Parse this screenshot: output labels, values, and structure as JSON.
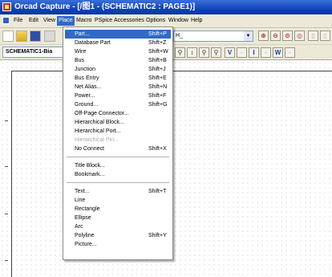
{
  "title_bar": {
    "title": "Orcad Capture - [/图1 - (SCHEMATIC2 : PAGE1)]"
  },
  "menu_bar": {
    "items": [
      "File",
      "Edit",
      "View",
      "Place",
      "Macro",
      "PSpice",
      "Accessories",
      "Options",
      "Window",
      "Help"
    ],
    "active": "Place"
  },
  "toolbar": {
    "part_combo": "H_",
    "sheet_tab": "SCHEMATIC1-Bia"
  },
  "place_menu": {
    "groups": [
      [
        {
          "label": "Part...",
          "shortcut": "Shift+P",
          "highlighted": true
        },
        {
          "label": "Database Part",
          "shortcut": "Shift+Z"
        },
        {
          "label": "Wire",
          "shortcut": "Shift+W"
        },
        {
          "label": "Bus",
          "shortcut": "Shift+B"
        },
        {
          "label": "Junction",
          "shortcut": "Shift+J"
        },
        {
          "label": "Bus Entry",
          "shortcut": "Shift+E"
        },
        {
          "label": "Net Alias...",
          "shortcut": "Shift+N"
        },
        {
          "label": "Power...",
          "shortcut": "Shift+F"
        },
        {
          "label": "Ground...",
          "shortcut": "Shift+G"
        },
        {
          "label": "Off-Page Connector...",
          "shortcut": ""
        },
        {
          "label": "Hierarchical Block...",
          "shortcut": ""
        },
        {
          "label": "Hierarchical Port...",
          "shortcut": ""
        },
        {
          "label": "Hierarchical Pin...",
          "shortcut": "",
          "disabled": true
        },
        {
          "label": "No Connect",
          "shortcut": "Shift+X"
        }
      ],
      [
        {
          "label": "Title Block...",
          "shortcut": ""
        },
        {
          "label": "Bookmark...",
          "shortcut": ""
        }
      ],
      [
        {
          "label": "Text...",
          "shortcut": "Shift+T"
        },
        {
          "label": "Line",
          "shortcut": ""
        },
        {
          "label": "Rectangle",
          "shortcut": ""
        },
        {
          "label": "Ellipse",
          "shortcut": ""
        },
        {
          "label": "Arc",
          "shortcut": ""
        },
        {
          "label": "Polyline",
          "shortcut": "Shift+Y"
        },
        {
          "label": "Picture...",
          "shortcut": ""
        }
      ]
    ]
  },
  "toolbar_letters": [
    "V",
    "I",
    "W"
  ]
}
